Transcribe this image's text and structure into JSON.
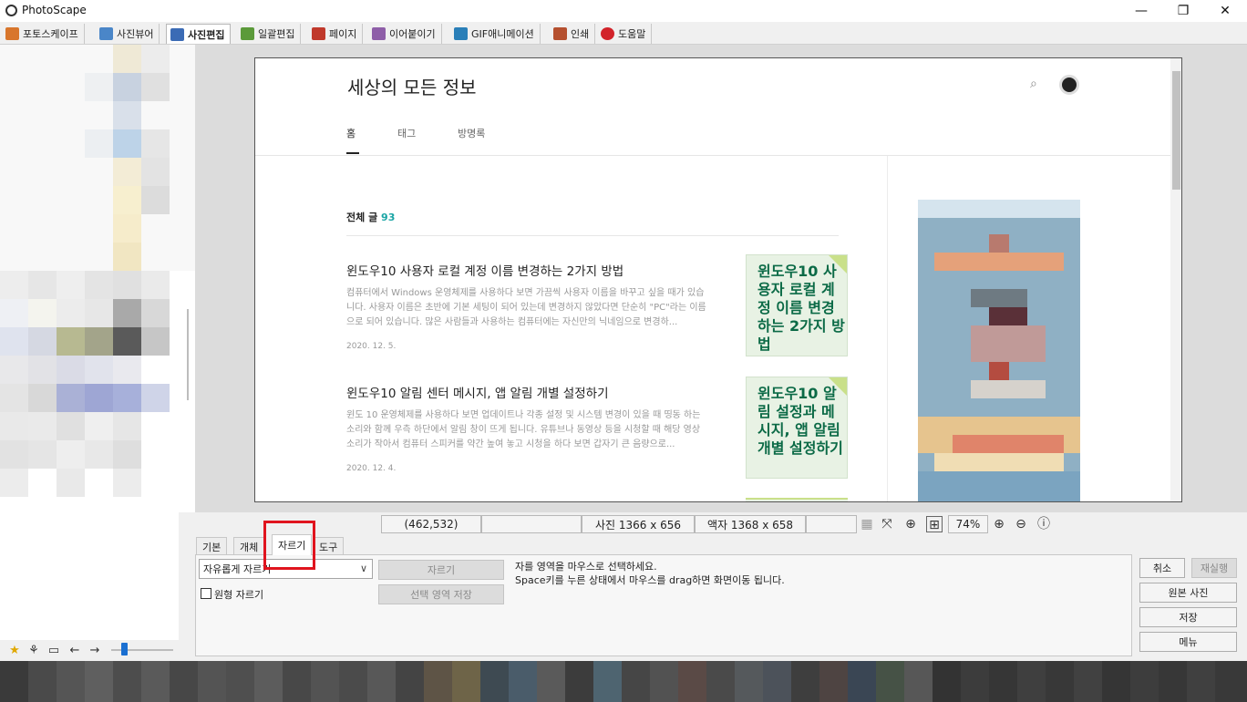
{
  "app": {
    "title": "PhotoScape",
    "controls": {
      "minimize": "—",
      "maximize": "❐",
      "close": "✕"
    }
  },
  "top_tabs": [
    {
      "label": "포토스케이프",
      "color": "#d8762c",
      "active": false
    },
    {
      "label": "사진뷰어",
      "color": "#4a86c8",
      "active": false
    },
    {
      "label": "사진편집",
      "color": "#3b6bb5",
      "active": true
    },
    {
      "label": "일괄편집",
      "color": "#5b9a3a",
      "active": false
    },
    {
      "label": "페이지",
      "color": "#c0392b",
      "active": false
    },
    {
      "label": "이어붙이기",
      "color": "#8e5ea8",
      "active": false
    },
    {
      "label": "GIF애니메이션",
      "color": "#2a7fb8",
      "active": false
    },
    {
      "label": "인쇄",
      "color": "#b5502f",
      "active": false
    },
    {
      "label": "도움말",
      "color": "#d2232a",
      "active": false
    }
  ],
  "blog": {
    "title": "세상의 모든 정보",
    "nav": [
      "홈",
      "태그",
      "방명록"
    ],
    "all_posts_label": "전체 글",
    "all_posts_count": "93",
    "posts": [
      {
        "title": "윈도우10 사용자 로컬 계정 이름 변경하는 2가지 방법",
        "excerpt": "컴퓨터에서 Windows 운영체제를 사용하다 보면 가끔씩 사용자 이름을 바꾸고 싶을 때가 있습니다. 사용자 이름은 초반에 기본 세팅이 되어 있는데 변경하지 않았다면 단순히 \"PC\"라는 이름으로 되어 있습니다. 많은 사람들과 사용하는 컴퓨터에는 자신만의 닉네임으로 변경하...",
        "date": "2020. 12. 5.",
        "thumb_text": "윈도우10 사용자 로컬 계정 이름 변경하는 2가지 방법"
      },
      {
        "title": "윈도우10 알림 센터 메시지, 앱 알림 개별 설정하기",
        "excerpt": "윈도 10 운영체제를 사용하다 보면 업데이트나 각종 설정 및 시스템 변경이 있을 때 띵동 하는 소리와 함께 우측 하단에서 알림 창이 뜨게 됩니다. 유튜브나 동영상 등을 시청할 때 해당 영상 소리가 작아서 컴퓨터 스피커를 약간 높여 놓고 시청을 하다 보면 갑자기 큰 음량으로...",
        "date": "2020. 12. 4.",
        "thumb_text": "윈도우10 알림 설정과 메시지, 앱 알림 개별 설정하기"
      }
    ]
  },
  "status_bar": {
    "coords": "(462,532)",
    "photo_size": "사진 1366 x 656",
    "frame_size": "액자 1368 x 658",
    "zoom": "74%"
  },
  "bottom_tabs": [
    {
      "label": "기본",
      "active": false
    },
    {
      "label": "개체",
      "active": false
    },
    {
      "label": "자르기",
      "active": true
    },
    {
      "label": "도구",
      "active": false
    }
  ],
  "crop_panel": {
    "mode_value": "자유롭게 자르기",
    "round_crop_label": "원형 자르기",
    "crop_button": "자르기",
    "save_selection_button": "선택 영역 저장",
    "hint1": "자를 영역을 마우스로 선택하세요.",
    "hint2": "Space키를 누른 상태에서 마우스를 drag하면 화면이동 됩니다."
  },
  "right_buttons": {
    "cancel": "취소",
    "redo": "재실행",
    "original": "원본 사진",
    "save": "저장",
    "menu": "메뉴"
  }
}
